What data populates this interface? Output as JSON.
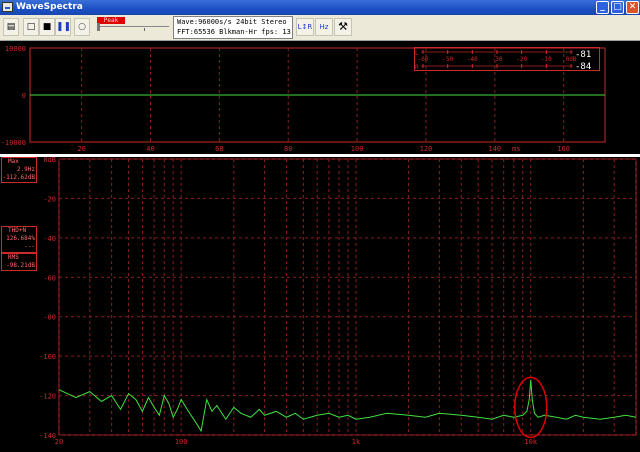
{
  "window": {
    "title": "WaveSpectra",
    "controls": {
      "minimize": "_",
      "maximize": "□",
      "close": "✕"
    }
  },
  "toolbar": {
    "peak_label": "Peak Hold",
    "wave_info": "Wave:96000s/s 24bit Stereo",
    "fft_info": "FFT:65536 Blkman-Hr  fps:",
    "fps_value": "13",
    "icons": [
      "open-icon",
      "new-icon",
      "stop-icon",
      "pause-icon",
      "record-icon",
      "channel-lr-icon",
      "freq-scale-icon",
      "settings-wrench-icon"
    ]
  },
  "level_meter": {
    "ticks": [
      "-60",
      "-50",
      "-40",
      "-30",
      "-20",
      "-10",
      "0dB"
    ],
    "left_value": "-81",
    "right_value": "-84",
    "left_channel": "L",
    "right_channel": "R"
  },
  "readouts": {
    "max_label": "Max",
    "max_freq": "2.9Hz",
    "max_level": "-112.62dB",
    "thd_label": "THD+N",
    "thd_value": "126.684%",
    "thd_sub": "---",
    "rms_label": "RMS",
    "rms_value": "-98.21dB"
  },
  "colors": {
    "grid": "#8a1e1e",
    "trace": "#40e040",
    "axis_text": "#cc2a2a",
    "annotation": "#e00000"
  },
  "chart_data": [
    {
      "type": "line",
      "title": "",
      "xlabel": "ms",
      "ylabel": "",
      "xlim": [
        5,
        172
      ],
      "ylim": [
        -10000,
        10000
      ],
      "x_ticks": [
        20,
        40,
        60,
        80,
        100,
        120,
        140,
        160
      ],
      "y_ticks": [
        10000,
        0,
        -10000
      ],
      "series": [
        {
          "x": [
            5,
            172
          ],
          "values": [
            0,
            0
          ]
        }
      ]
    },
    {
      "type": "line",
      "title": "",
      "xlabel": "",
      "ylabel": "",
      "x_scale": "log",
      "xlim": [
        20,
        40000
      ],
      "ylim": [
        -140,
        0
      ],
      "y_ticks": [
        0,
        -20,
        -40,
        -60,
        -80,
        -100,
        -120,
        -140
      ],
      "y_tick_labels": [
        "0dB",
        "-20",
        "-40",
        "-60",
        "-80",
        "-100",
        "-120",
        "-140"
      ],
      "x_tick_labels": [
        {
          "x": 20,
          "label": "20"
        },
        {
          "x": 100,
          "label": "100"
        },
        {
          "x": 1000,
          "label": "1k"
        },
        {
          "x": 10000,
          "label": "10k"
        }
      ],
      "annotation": {
        "type": "ellipse",
        "x": 10000,
        "y": -126
      },
      "series": [
        {
          "x": [
            20,
            25,
            30,
            35,
            40,
            45,
            50,
            55,
            60,
            65,
            70,
            75,
            80,
            85,
            90,
            95,
            100,
            110,
            120,
            130,
            140,
            150,
            160,
            180,
            200,
            220,
            250,
            280,
            300,
            350,
            400,
            450,
            500,
            600,
            700,
            800,
            900,
            1000,
            1200,
            1500,
            2000,
            2500,
            3000,
            4000,
            5000,
            6000,
            7000,
            8000,
            9000,
            9500,
            9800,
            10000,
            10200,
            10500,
            11000,
            12000,
            14000,
            16000,
            18000,
            20000,
            25000,
            30000,
            35000,
            40000
          ],
          "values": [
            -117,
            -121,
            -118,
            -123,
            -120,
            -127,
            -119,
            -122,
            -128,
            -121,
            -126,
            -130,
            -120,
            -124,
            -131,
            -127,
            -122,
            -128,
            -133,
            -138,
            -122,
            -128,
            -125,
            -132,
            -126,
            -129,
            -131,
            -127,
            -130,
            -128,
            -131,
            -129,
            -132,
            -130,
            -129,
            -131,
            -130,
            -132,
            -131,
            -129,
            -130,
            -131,
            -129,
            -130,
            -131,
            -132,
            -130,
            -131,
            -130,
            -128,
            -122,
            -112,
            -122,
            -129,
            -131,
            -130,
            -131,
            -132,
            -130,
            -131,
            -132,
            -131,
            -130,
            -131
          ]
        }
      ]
    }
  ]
}
